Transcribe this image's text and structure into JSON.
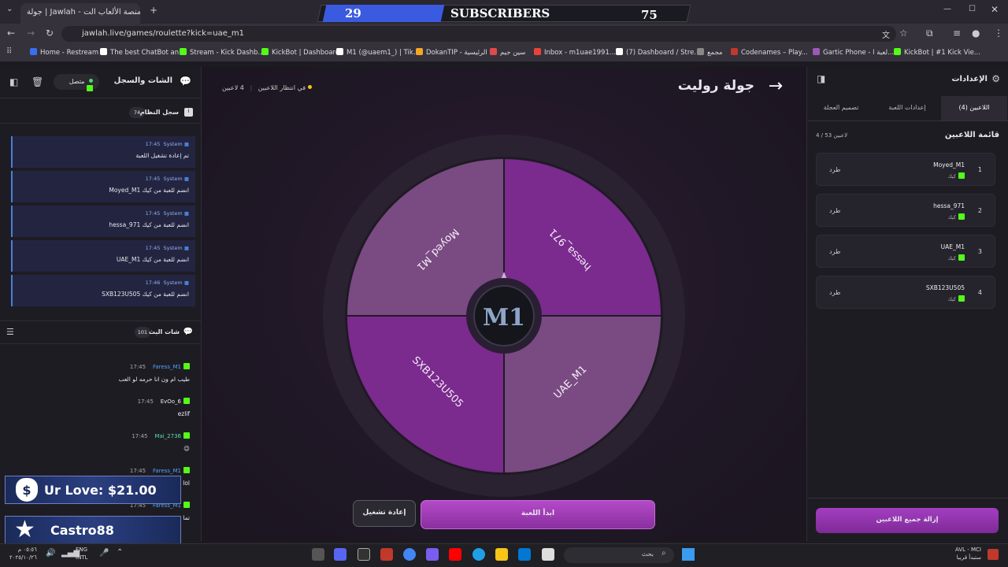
{
  "browser": {
    "tab_title": "جولة | Jawlah - منصة الألعاب الت...",
    "url": "jawlah.live/games/roulette?kick=uae_m1",
    "bookmarks": [
      {
        "label": "Home - Restream",
        "color": "#3a6ef0"
      },
      {
        "label": "The best ChatBot an...",
        "color": "#ffffff"
      },
      {
        "label": "Stream - Kick Dashb...",
        "color": "#53fc18"
      },
      {
        "label": "KickBot | Dashboard",
        "color": "#53fc18"
      },
      {
        "label": "M1 (@uaem1_) | Tik...",
        "color": "#ffffff"
      },
      {
        "label": "DokanTIP - الرئيسية",
        "color": "#f5a623"
      },
      {
        "label": "سين جيم",
        "color": "#e04a4a"
      },
      {
        "label": "Inbox - m1uae1991...",
        "color": "#ea4335"
      },
      {
        "label": "(7) Dashboard / Stre...",
        "color": "#ffffff"
      },
      {
        "label": "مجمع",
        "color": "#888888"
      },
      {
        "label": "Codenames – Play...",
        "color": "#c0392b"
      },
      {
        "label": "Gartic Phone - لعبة ا...",
        "color": "#9b59b6"
      },
      {
        "label": "KickBot | #1 Kick Vie...",
        "color": "#53fc18"
      }
    ]
  },
  "overlay": {
    "sub_left": "29",
    "sub_label": "SUBSCRIBERS",
    "sub_right": "75",
    "love": "Ur Love: $21.00",
    "follower": "Castro88"
  },
  "left": {
    "title": "الشات والسجل",
    "status": "متصل",
    "system_log_title": "سجل النظام",
    "system_log_count": "74",
    "system_logs": [
      {
        "time": "17:45",
        "sender": "System",
        "msg": "تم إعادة تشغيل اللعبة"
      },
      {
        "time": "17:45",
        "sender": "System",
        "msg": "Moyed_M1 انضم للعبة من كيك"
      },
      {
        "time": "17:45",
        "sender": "System",
        "msg": "hessa_971 انضم للعبة من كيك"
      },
      {
        "time": "17:45",
        "sender": "System",
        "msg": "UAE_M1 انضم للعبة من كيك"
      },
      {
        "time": "17:46",
        "sender": "System",
        "msg": "SXB123U505 انضم للعبة من كيك"
      }
    ],
    "chat_title": "شات البث",
    "chat_count": "101",
    "chat": [
      {
        "time": "17:45",
        "user": "Faress_M1",
        "user_color": "#4fa3ff",
        "msg": "طيب ام ون انا حرمه لو العب"
      },
      {
        "time": "17:45",
        "user": "EvOo_6",
        "user_color": "#e8e8e8",
        "msg": "ezlif"
      },
      {
        "time": "17:45",
        "user": "Mai_2736",
        "user_color": "#53e0a8",
        "msg": "😉"
      },
      {
        "time": "17:45",
        "user": "Faress_M1",
        "user_color": "#4fa3ff",
        "msg": "lol"
      },
      {
        "time": "17:45",
        "user": "Faress_M1",
        "user_color": "#4fa3ff",
        "msg": "تما"
      }
    ]
  },
  "stage": {
    "title": "جولة روليت",
    "players_count": "4 لاعبين",
    "waiting": "في انتظار اللاعبين",
    "center_logo": "M1",
    "segments": [
      {
        "name": "hessa_971",
        "color": "#7b2a8e"
      },
      {
        "name": "UAE_M1",
        "color": "#7a4a82"
      },
      {
        "name": "SXB123U505",
        "color": "#7b2a8e"
      },
      {
        "name": "Moyed_M1",
        "color": "#7a4a82"
      }
    ],
    "restart_label": "إعادة تشغيل",
    "start_label": "ابدأ اللعبة"
  },
  "right": {
    "title": "الإعدادات",
    "tabs": [
      "اللاعبين (4)",
      "إعدادات اللعبة",
      "تصميم العجلة"
    ],
    "list_title": "قائمة اللاعبين",
    "list_count": "4 / 53 لاعبين",
    "players": [
      {
        "num": "1",
        "name": "Moyed_M1",
        "platform": "كيك",
        "kick": "طرد"
      },
      {
        "num": "2",
        "name": "hessa_971",
        "platform": "كيك",
        "kick": "طرد"
      },
      {
        "num": "3",
        "name": "UAE_M1",
        "platform": "كيك",
        "kick": "طرد"
      },
      {
        "num": "4",
        "name": "SXB123U505",
        "platform": "كيك",
        "kick": "طرد"
      }
    ],
    "remove_all": "إزالة جميع اللاعبين"
  },
  "taskbar": {
    "search": "بحث",
    "lang": "ENG",
    "layout": "INTL",
    "weather_title": "AVL - MCI",
    "weather_sub": "ستبدأ قريبا",
    "time": "٠٥:٥٦ م",
    "date": "٢٠٢٥/١٠/٢٦"
  }
}
